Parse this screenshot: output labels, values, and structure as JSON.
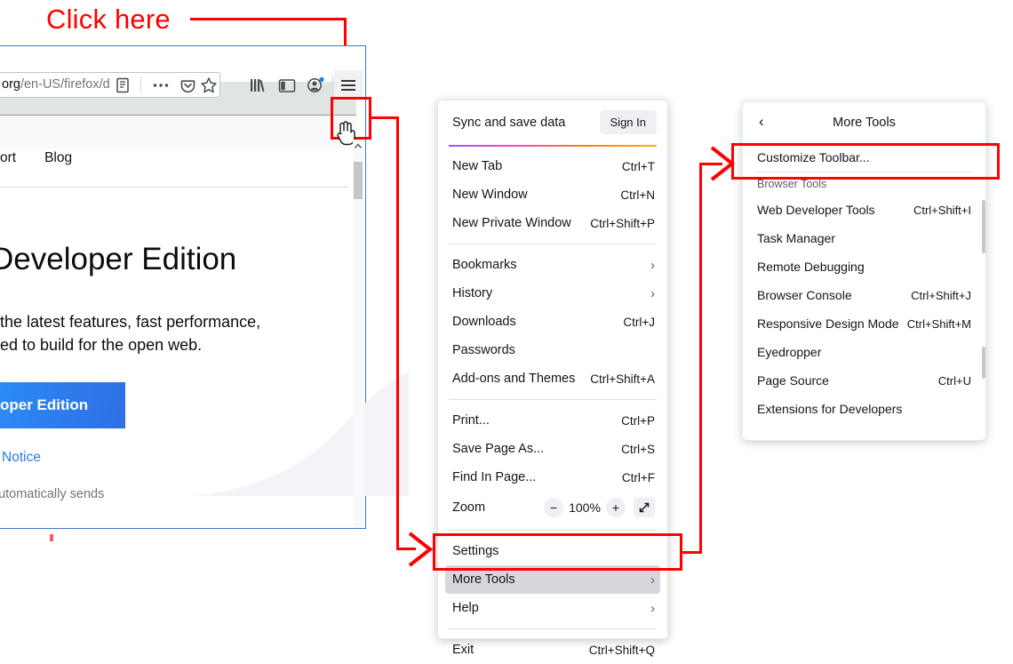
{
  "annotation": {
    "click_here": "Click here",
    "color": "#ff0000"
  },
  "browser": {
    "url_visible": "org/en-US/firefox/d",
    "url_prefix": "org",
    "url_rest": "/en-US/firefox/d",
    "toolbar_icons": [
      "reader-view-icon",
      "page-actions-dots-icon",
      "pocket-icon",
      "bookmark-star-icon",
      "library-icon",
      "sidebar-icon",
      "account-icon",
      "hamburger-menu-icon"
    ],
    "page_nav": [
      "ort",
      "Blog"
    ],
    "hero": {
      "title": "Developer Edition",
      "sub_line1": "t the latest features, fast performance,",
      "sub_line2": "eed to build for the open web.",
      "cta": "oper Edition",
      "link": "y Notice",
      "note": "automatically sends"
    }
  },
  "menu": {
    "sync": {
      "label": "Sync and save data",
      "sign_in": "Sign In"
    },
    "groups": [
      [
        {
          "label": "New Tab",
          "key": "Ctrl+T"
        },
        {
          "label": "New Window",
          "key": "Ctrl+N"
        },
        {
          "label": "New Private Window",
          "key": "Ctrl+Shift+P"
        }
      ],
      [
        {
          "label": "Bookmarks",
          "key": "",
          "chevron": "›"
        },
        {
          "label": "History",
          "key": "",
          "chevron": "›"
        },
        {
          "label": "Downloads",
          "key": "Ctrl+J"
        },
        {
          "label": "Passwords",
          "key": ""
        },
        {
          "label": "Add-ons and Themes",
          "key": "Ctrl+Shift+A"
        }
      ],
      [
        {
          "label": "Print...",
          "key": "Ctrl+P"
        },
        {
          "label": "Save Page As...",
          "key": "Ctrl+S"
        },
        {
          "label": "Find In Page...",
          "key": "Ctrl+F"
        }
      ]
    ],
    "zoom": {
      "label": "Zoom",
      "minus": "−",
      "value": "100%",
      "plus": "+",
      "fullscreen_icon": "expand-icon"
    },
    "tail": [
      {
        "label": "Settings",
        "key": "",
        "chevron": ""
      },
      {
        "label": "More Tools",
        "key": "",
        "chevron": "›",
        "highlighted": true
      },
      {
        "label": "Help",
        "key": "",
        "chevron": "›"
      }
    ],
    "exit": {
      "label": "Exit",
      "key": "Ctrl+Shift+Q"
    }
  },
  "submenu": {
    "back_icon": "‹",
    "title": "More Tools",
    "customize": {
      "label": "Customize Toolbar...",
      "key": ""
    },
    "group_heading": "Browser Tools",
    "items": [
      {
        "label": "Web Developer Tools",
        "key": "Ctrl+Shift+I"
      },
      {
        "label": "Task Manager",
        "key": ""
      },
      {
        "label": "Remote Debugging",
        "key": ""
      },
      {
        "label": "Browser Console",
        "key": "Ctrl+Shift+J"
      },
      {
        "label": "Responsive Design Mode",
        "key": "Ctrl+Shift+M"
      },
      {
        "label": "Eyedropper",
        "key": ""
      },
      {
        "label": "Page Source",
        "key": "Ctrl+U"
      },
      {
        "label": "Extensions for Developers",
        "key": ""
      }
    ]
  }
}
